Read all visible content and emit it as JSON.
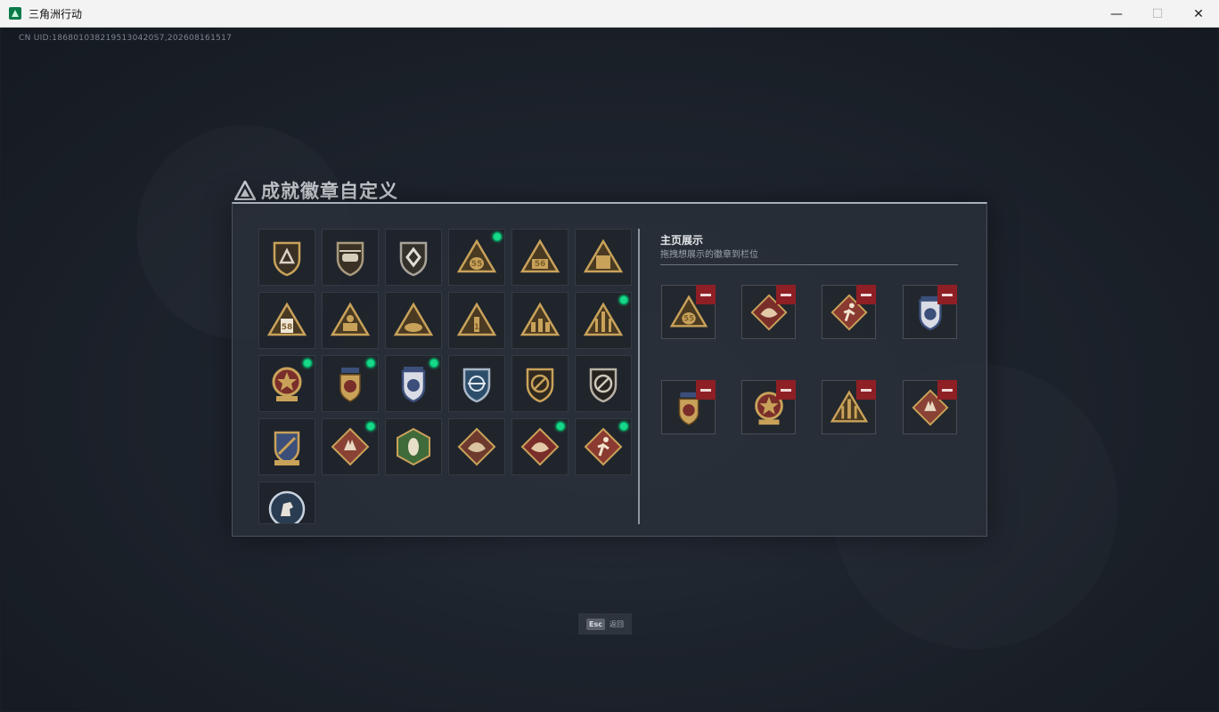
{
  "window": {
    "title": "三角洲行动",
    "minimize_glyph": "—",
    "maximize_glyph": "☐",
    "close_glyph": "✕"
  },
  "uid_text": "CN UID:1868010382195130420S7,202608161517",
  "panel": {
    "title": "成就徽章自定义"
  },
  "showcase": {
    "title": "主页展示",
    "subtitle": "拖拽想展示的徽章到栏位"
  },
  "esc": {
    "key": "Esc",
    "label": "返回"
  },
  "badges": [
    {
      "icon": "shield-delta-icon",
      "new": false
    },
    {
      "icon": "helicopter-shield-icon",
      "new": false
    },
    {
      "icon": "diamond-shield-icon",
      "new": false
    },
    {
      "icon": "money-bag-triangle-icon",
      "new": true,
      "text": "55"
    },
    {
      "icon": "triangle-56-icon",
      "new": false,
      "text": "56"
    },
    {
      "icon": "crate-triangle-icon",
      "new": false
    },
    {
      "icon": "card-58-triangle-icon",
      "new": false,
      "text": "58"
    },
    {
      "icon": "soldier-triangle-icon",
      "new": false
    },
    {
      "icon": "egg-nest-triangle-icon",
      "new": false
    },
    {
      "icon": "number-one-triangle-icon",
      "new": false,
      "text": "1"
    },
    {
      "icon": "squad-triangle-icon",
      "new": false
    },
    {
      "icon": "missile-triangle-icon",
      "new": true
    },
    {
      "icon": "star-medal-red-icon",
      "new": true
    },
    {
      "icon": "winged-medal-icon",
      "new": true
    },
    {
      "icon": "eagle-shield-icon",
      "new": true
    },
    {
      "icon": "crosshair-shield-icon",
      "new": false
    },
    {
      "icon": "no-rifle-shield-icon",
      "new": false
    },
    {
      "icon": "no-rifle-dark-shield-icon",
      "new": false
    },
    {
      "icon": "crossed-rifles-shield-icon",
      "new": false
    },
    {
      "icon": "wolf-diamond-icon",
      "new": true
    },
    {
      "icon": "hornet-hexagon-icon",
      "new": false
    },
    {
      "icon": "dragon-diamond-icon",
      "new": false
    },
    {
      "icon": "dragon-red-diamond-icon",
      "new": true
    },
    {
      "icon": "runner-diamond-icon",
      "new": true
    },
    {
      "icon": "horse-circle-icon",
      "new": false
    }
  ],
  "slots": [
    {
      "icon": "money-bag-triangle-icon",
      "text": "55"
    },
    {
      "icon": "dragon-red-diamond-icon"
    },
    {
      "icon": "runner-diamond-icon"
    },
    {
      "icon": "eagle-shield-icon"
    },
    {
      "icon": "winged-medal-icon"
    },
    {
      "icon": "star-medal-red-icon"
    },
    {
      "icon": "missile-triangle-icon"
    },
    {
      "icon": "wolf-diamond-icon"
    }
  ],
  "colors": {
    "gold": "#c9a25a",
    "gold_dark": "#7d5f2c",
    "maroon": "#7a2e2a",
    "navy": "#3b4f7a",
    "new_dot": "#18d88a",
    "remove": "#8e1f24"
  }
}
